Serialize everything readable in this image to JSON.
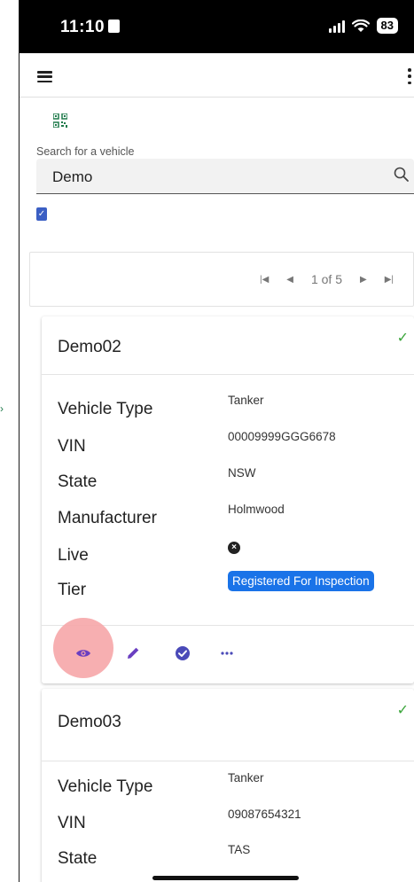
{
  "status_bar": {
    "time": "11:10",
    "battery": "83"
  },
  "search": {
    "label": "Search for a vehicle",
    "value": "Demo"
  },
  "pager": {
    "count": "1 of 5"
  },
  "field_labels": {
    "vehicle_type": "Vehicle Type",
    "vin": "VIN",
    "state": "State",
    "manufacturer": "Manufacturer",
    "live": "Live",
    "tier": "Tier"
  },
  "vehicles": [
    {
      "name": "Demo02",
      "vehicle_type": "Tanker",
      "vin": "00009999GGG6678",
      "state": "NSW",
      "manufacturer": "Holmwood",
      "live": false,
      "tier": "Registered For Inspection"
    },
    {
      "name": "Demo03",
      "vehicle_type": "Tanker",
      "vin": "09087654321",
      "state": "TAS"
    }
  ],
  "colors": {
    "accent": "#1a73e8",
    "check": "#3aa53a",
    "action_purple": "#6a3fc1",
    "ripple": "#f6a6a8"
  },
  "icons": [
    "menu-icon",
    "kebab-icon",
    "qr-code-icon",
    "search-icon",
    "check-icon",
    "first-page-icon",
    "prev-page-icon",
    "next-page-icon",
    "last-page-icon",
    "close-circle-icon",
    "eye-icon",
    "pencil-icon",
    "check-circle-icon",
    "more-horizontal-icon"
  ]
}
